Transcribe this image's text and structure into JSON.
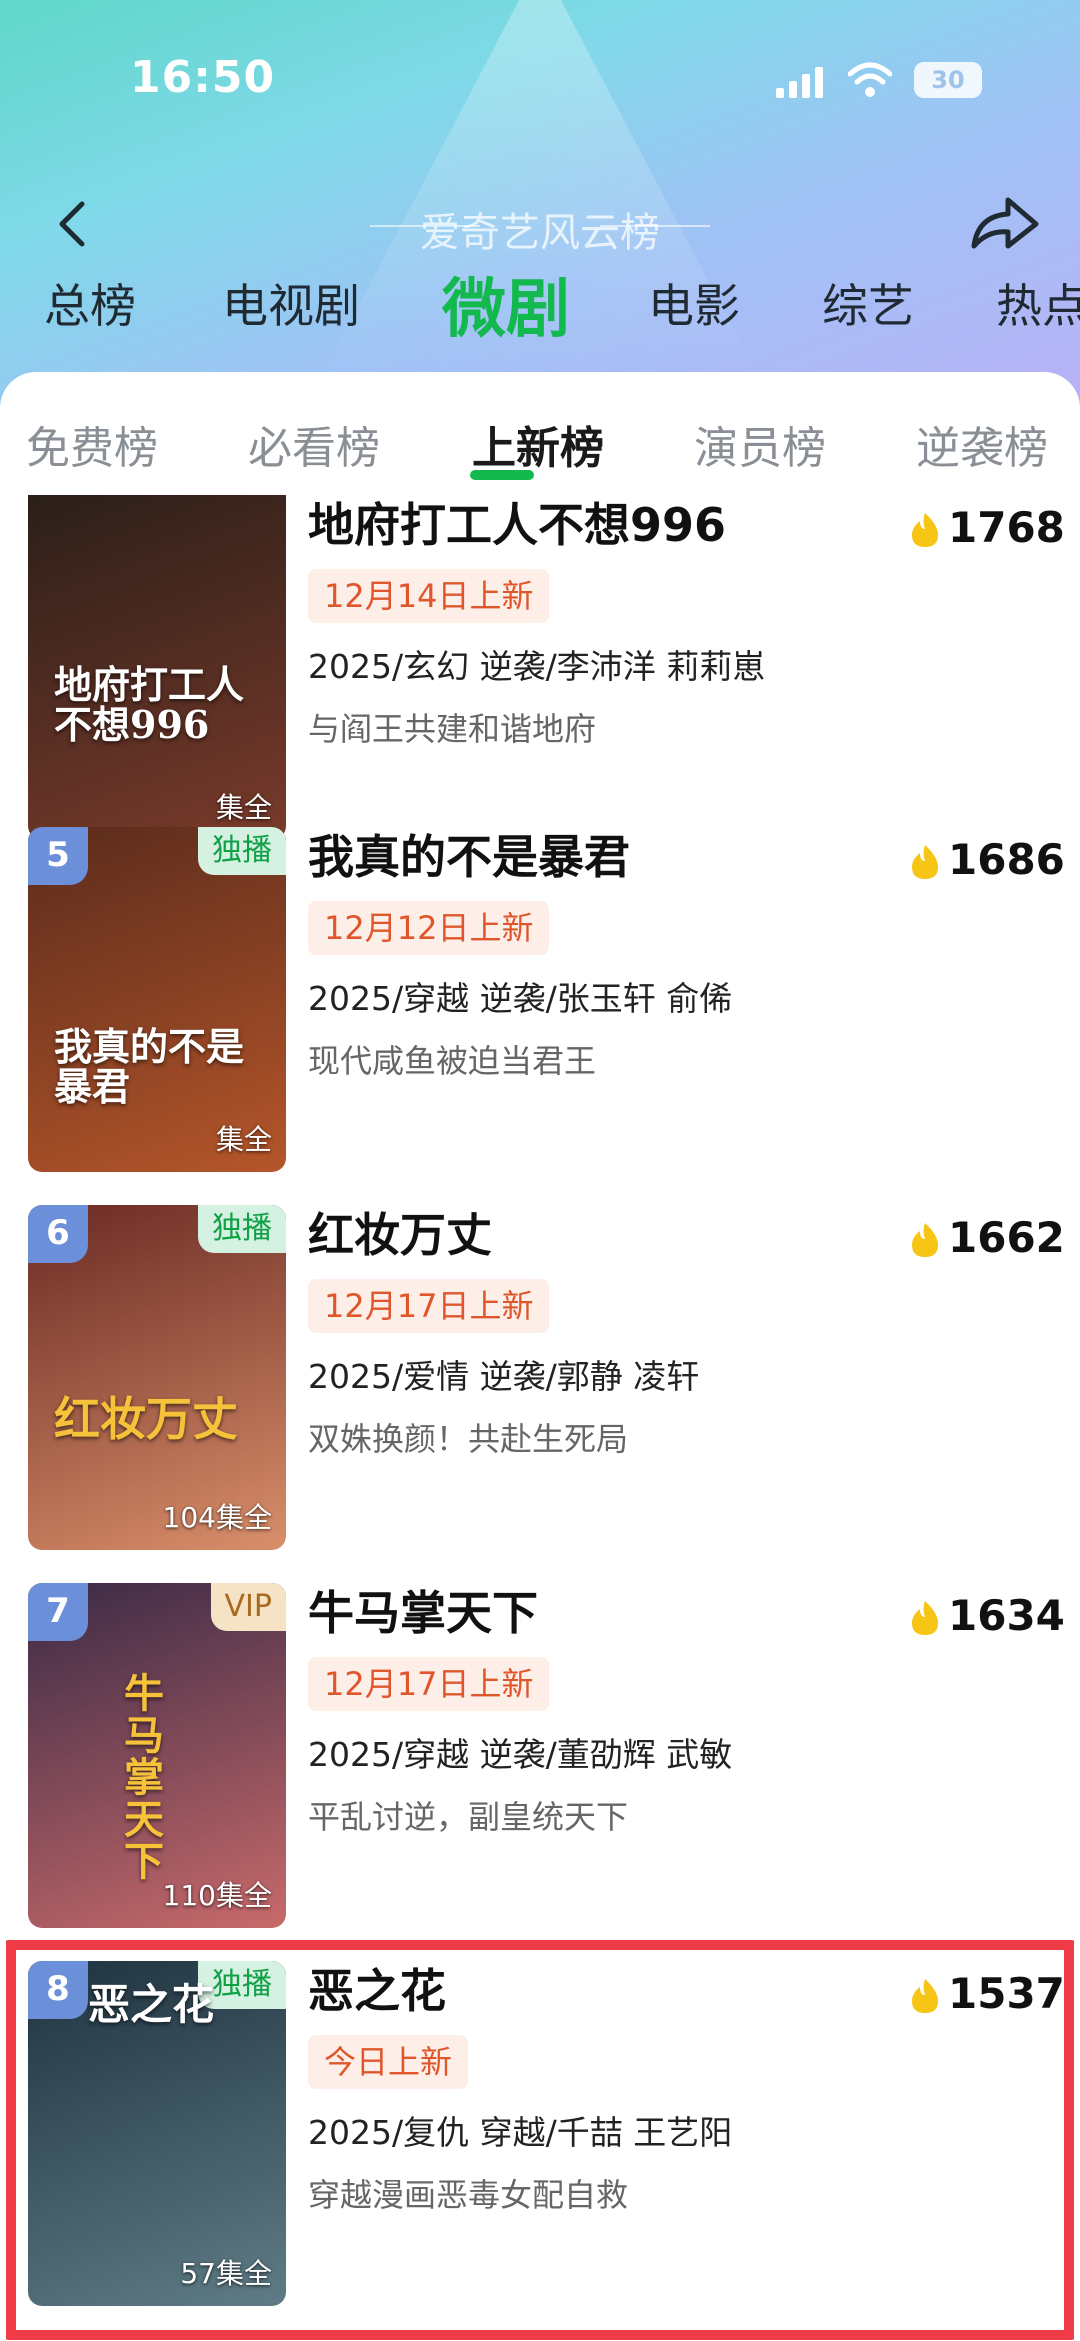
{
  "status": {
    "time": "16:50",
    "battery": "30"
  },
  "nav": {
    "title": "爱奇艺风云榜"
  },
  "category_tabs": [
    {
      "label": "总榜",
      "active": false
    },
    {
      "label": "电视剧",
      "active": false
    },
    {
      "label": "微剧",
      "active": true
    },
    {
      "label": "电影",
      "active": false
    },
    {
      "label": "综艺",
      "active": false
    },
    {
      "label": "热点",
      "active": false
    }
  ],
  "sub_tabs": [
    {
      "label": "免费榜",
      "active": false
    },
    {
      "label": "必看榜",
      "active": false
    },
    {
      "label": "上新榜",
      "active": true
    },
    {
      "label": "演员榜",
      "active": false
    },
    {
      "label": "逆袭榜",
      "active": false
    }
  ],
  "items": [
    {
      "rank": "",
      "tag": "",
      "title": "地府打工人不想996",
      "date": "12月14日上新",
      "meta": "2025/玄幻 逆袭/李沛洋 莉莉崽",
      "desc": "与阎王共建和谐地府",
      "heat": "1768",
      "poster_text": "地府打工人不想996",
      "episodes": "集全",
      "poster_colors": [
        "#2b1f1a",
        "#7a3a2a"
      ]
    },
    {
      "rank": "5",
      "tag": "独播",
      "title": "我真的不是暴君",
      "date": "12月12日上新",
      "meta": "2025/穿越 逆袭/张玉轩 俞俙",
      "desc": "现代咸鱼被迫当君王",
      "heat": "1686",
      "poster_text": "我真的不是暴君",
      "episodes": "集全",
      "poster_colors": [
        "#5a2b1c",
        "#b5562a"
      ]
    },
    {
      "rank": "6",
      "tag": "独播",
      "title": "红妆万丈",
      "date": "12月17日上新",
      "meta": "2025/爱情 逆袭/郭静 凌轩",
      "desc": "双姝换颜！共赴生死局",
      "heat": "1662",
      "poster_text": "红妆万丈",
      "episodes": "104集全",
      "poster_colors": [
        "#6a2a24",
        "#d98f6a"
      ]
    },
    {
      "rank": "7",
      "tag": "VIP",
      "title": "牛马掌天下",
      "date": "12月17日上新",
      "meta": "2025/穿越 逆袭/董劭辉 武敏",
      "desc": "平乱讨逆，副皇统天下",
      "heat": "1634",
      "poster_text": "牛马掌天下",
      "episodes": "110集全",
      "poster_colors": [
        "#3a2a46",
        "#c86a6a"
      ]
    },
    {
      "rank": "8",
      "tag": "独播",
      "title": "恶之花",
      "date": "今日上新",
      "meta": "2025/复仇 穿越/千喆 王艺阳",
      "desc": "穿越漫画恶毒女配自救",
      "heat": "1537",
      "poster_text": "恶之花",
      "episodes": "57集全",
      "poster_colors": [
        "#1f3340",
        "#5f7c86"
      ]
    }
  ],
  "colors": {
    "accent": "#13b84f",
    "date_tag": "#e0562b",
    "highlight": "#ef3b45",
    "rank_badge": "#6b8fd8"
  }
}
